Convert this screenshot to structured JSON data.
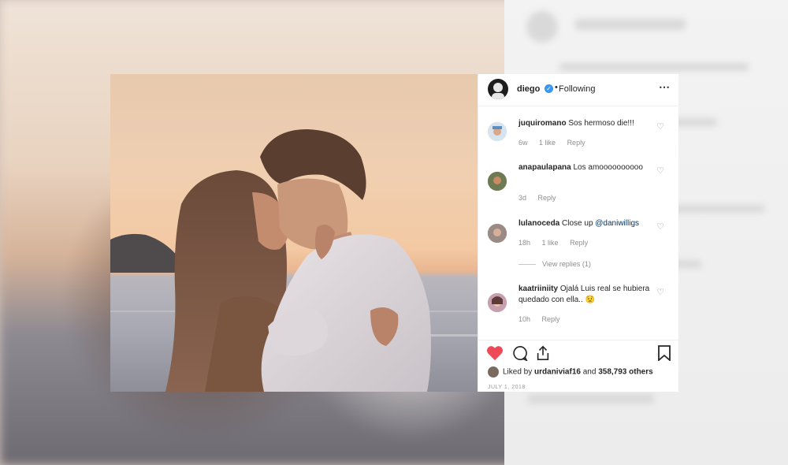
{
  "post": {
    "username": "diego",
    "separator": "•",
    "follow_state": "Following",
    "more_icon": "⋯"
  },
  "comments": [
    {
      "user": "juquiromano",
      "text": "Sos hermoso die!!!",
      "time": "6w",
      "likes": "1 like",
      "reply": "Reply"
    },
    {
      "user": "anapaulapana",
      "text": "Los amoooooooooo",
      "time": "3d",
      "reply": "Reply"
    },
    {
      "user": "lulanoceda",
      "text": "Close up",
      "mention": "@daniwilligs",
      "time": "18h",
      "likes": "1 like",
      "reply": "Reply",
      "view_replies": "View replies (1)"
    },
    {
      "user": "kaatriiniity",
      "text": "Ojalá Luis real se hubiera quedado con ella..",
      "emoji": "😟",
      "time": "10h",
      "reply": "Reply"
    }
  ],
  "likes": {
    "prefix": "Liked by",
    "user": "urdaniviaf16",
    "joiner": "and",
    "others": "358,793 others"
  },
  "date": "JULY 1, 2018",
  "colors": {
    "like_red": "#ed4956",
    "verified_blue": "#3897f0"
  },
  "icons": [
    "heart-icon",
    "comment-icon",
    "share-icon",
    "bookmark-icon",
    "verified-icon",
    "more-icon"
  ]
}
